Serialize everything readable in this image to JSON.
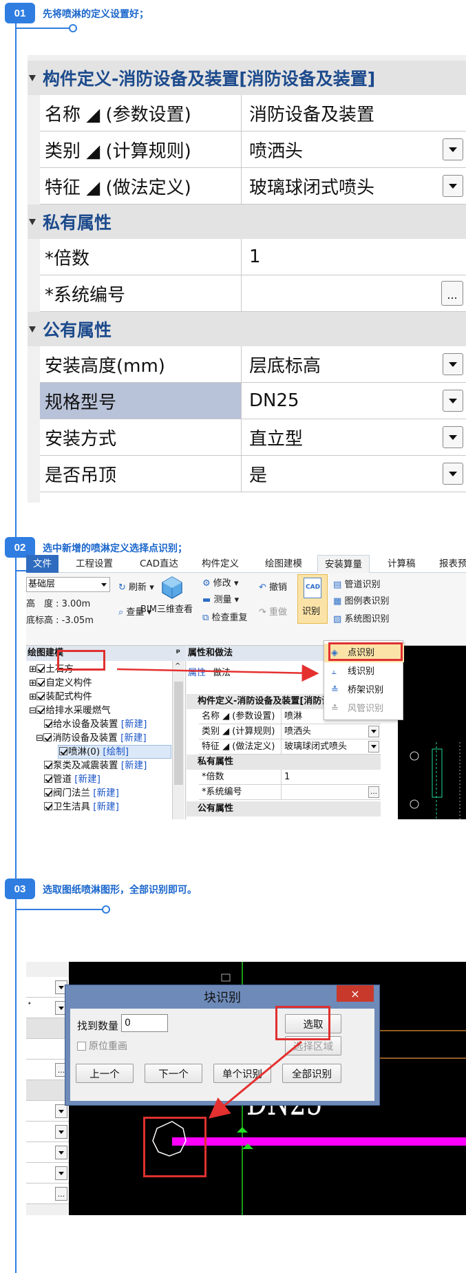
{
  "steps": [
    {
      "num": "01",
      "title": "先将喷淋的定义设置好；"
    },
    {
      "num": "02",
      "title": "选中新增的喷淋定义选择点识别；"
    },
    {
      "num": "03",
      "title": "选取图纸喷淋图形，全部识别即可。"
    }
  ],
  "panel1": {
    "header": "构件定义-消防设备及装置[消防设备及装置]",
    "rows1": [
      {
        "label": "名称 ◢ (参数设置)",
        "value": "消防设备及装置"
      },
      {
        "label": "类别 ◢ (计算规则)",
        "value": "喷洒头"
      },
      {
        "label": "特征 ◢ (做法定义)",
        "value": "玻璃球闭式喷头"
      }
    ],
    "private_title": "私有属性",
    "rows2": [
      {
        "label": "*倍数",
        "value": "1"
      },
      {
        "label": "*系统编号",
        "value": ""
      }
    ],
    "public_title": "公有属性",
    "rows3": [
      {
        "label": "安装高度(mm)",
        "value": "层底标高"
      },
      {
        "label": "规格型号",
        "value": "DN25"
      },
      {
        "label": "安装方式",
        "value": "直立型"
      },
      {
        "label": "是否吊顶",
        "value": "是"
      }
    ],
    "ellipsis": "..."
  },
  "panel2": {
    "menu": [
      "文件",
      "工程设置",
      "CAD直达",
      "构件定义",
      "绘图建模",
      "安装算量",
      "计算稿",
      "报表预"
    ],
    "ribbon": {
      "floor": "基础层",
      "height": "高　度 : 3.00m",
      "bottom": "底标高 : -3.05m",
      "refresh": "刷新",
      "check": "查量",
      "bim": "BIM三维查看",
      "modify": "修改",
      "measure": "测量",
      "checkdup": "检查重复",
      "undo": "撤销",
      "redo": "重做",
      "recog": "识别",
      "pipe": "管道识别",
      "legend": "图例表识别",
      "system": "系统图识别"
    },
    "popup": [
      "点识别",
      "线识别",
      "桥架识别",
      "风管识别"
    ],
    "tree": {
      "header": "绘图建模",
      "pin": "ᵖ",
      "items": [
        {
          "text": "土石方",
          "new": ""
        },
        {
          "text": "自定义构件",
          "new": ""
        },
        {
          "text": "装配式构件",
          "new": ""
        },
        {
          "text": "给排水采暖燃气",
          "new": ""
        },
        {
          "text": "给水设备及装置",
          "new": "[新建]"
        },
        {
          "text": "消防设备及装置",
          "new": "[新建]"
        },
        {
          "text": "喷淋(0)",
          "new": "[绘制]"
        },
        {
          "text": "泵类及减震装置",
          "new": "[新建]"
        },
        {
          "text": "管道",
          "new": "[新建]"
        },
        {
          "text": "阀门法兰",
          "new": "[新建]"
        },
        {
          "text": "卫生洁具",
          "new": "[新建]"
        }
      ]
    },
    "props": {
      "header": "属性和做法",
      "tab1": "属性",
      "tab2": "做法",
      "def": "构件定义-消防设备及装置[消防设",
      "rows": [
        {
          "label": "名称 ◢ (参数设置)",
          "value": "喷淋"
        },
        {
          "label": "类别 ◢ (计算规则)",
          "value": "喷洒头"
        },
        {
          "label": "特征 ◢ (做法定义)",
          "value": "玻璃球闭式喷头"
        }
      ],
      "private": "私有属性",
      "rows2": [
        {
          "label": "*倍数",
          "value": "1"
        },
        {
          "label": "*系统编号",
          "value": ""
        }
      ],
      "public": "公有属性"
    }
  },
  "panel3": {
    "title": "块识别",
    "close": "×",
    "found_label": "找到数量",
    "found_value": "0",
    "reset": "原位重画",
    "select": "选取",
    "area": "选择区域",
    "prev": "上一个",
    "next": "下一个",
    "single": "单个识别",
    "all": "全部识别",
    "cad_text": "DN25",
    "left_glyph": "ᐩ",
    "ellipsis": "..."
  }
}
